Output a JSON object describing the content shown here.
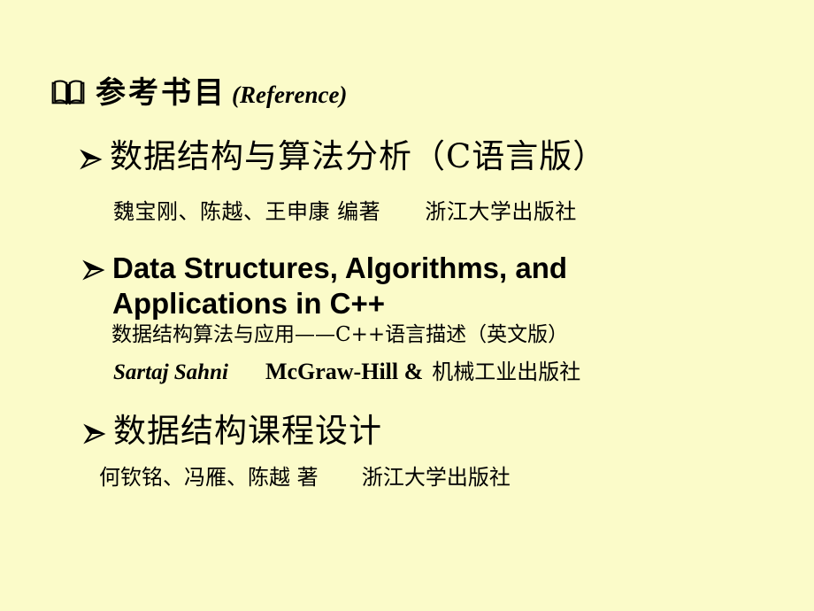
{
  "slide": {
    "background_color": "#fbfbc9",
    "text_color": "#000000",
    "title": {
      "icon": "open-book-icon",
      "cn": "参考书目",
      "en": "(Reference)"
    },
    "entries": [
      {
        "bullet": "arrow-bullet-icon",
        "title": "数据结构与算法分析（C语言版）",
        "subtitle": "",
        "authors": "魏宝刚、陈越、王申康 编著",
        "publisher": "浙江大学出版社"
      },
      {
        "bullet": "arrow-bullet-icon",
        "title_line1": "Data  Structures,  Algorithms,  and",
        "title_line2": "Applications  in  C++",
        "subtitle": "数据结构算法与应用——C++语言描述（英文版）",
        "authors": "Sartaj Sahni",
        "publisher_en": "McGraw-Hill  &",
        "publisher_cn": "机械工业出版社"
      },
      {
        "bullet": "arrow-bullet-icon",
        "title": "数据结构课程设计",
        "authors": "何钦铭、冯雁、陈越 著",
        "publisher": "浙江大学出版社"
      }
    ]
  }
}
